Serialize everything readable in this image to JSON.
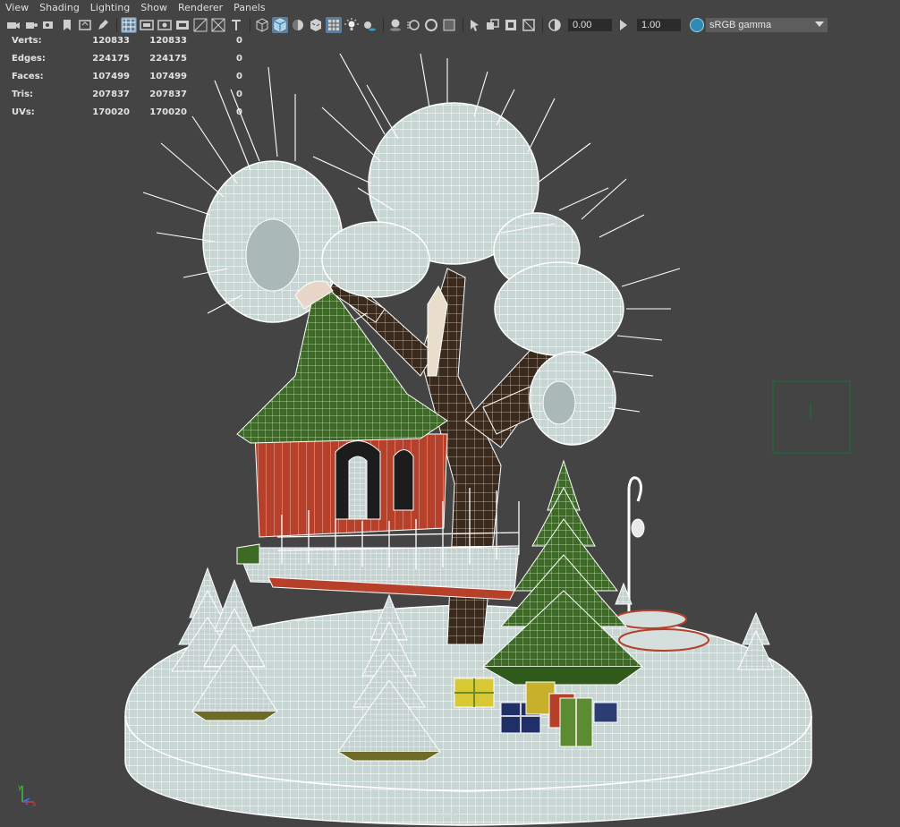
{
  "menu": [
    "View",
    "Shading",
    "Lighting",
    "Show",
    "Renderer",
    "Panels"
  ],
  "toolbar": {
    "exposure_value": "0.00",
    "gamma_value": "1.00",
    "color_management": "sRGB gamma"
  },
  "hud": {
    "rows": [
      {
        "label": "Verts:",
        "v1": "120833",
        "v2": "120833",
        "v3": "0"
      },
      {
        "label": "Edges:",
        "v1": "224175",
        "v2": "224175",
        "v3": "0"
      },
      {
        "label": "Faces:",
        "v1": "107499",
        "v2": "107499",
        "v3": "0"
      },
      {
        "label": "Tris:",
        "v1": "207837",
        "v2": "207837",
        "v3": "0"
      },
      {
        "label": "UVs:",
        "v1": "170020",
        "v2": "170020",
        "v3": "0"
      }
    ]
  },
  "viewport": {
    "camera": "persp"
  },
  "axis": {
    "x": "x",
    "y": "y",
    "z": "z"
  },
  "colors": {
    "background": "#444444",
    "wire": "#ffffff",
    "mesh_shade": "#c8d6d4",
    "roof_green": "#3d6b25",
    "house_red": "#b6402a",
    "trunk_brown": "#3a2a1d",
    "active_toolbar": "#5c7f9e",
    "gizmo_green": "#1f6a3a"
  }
}
